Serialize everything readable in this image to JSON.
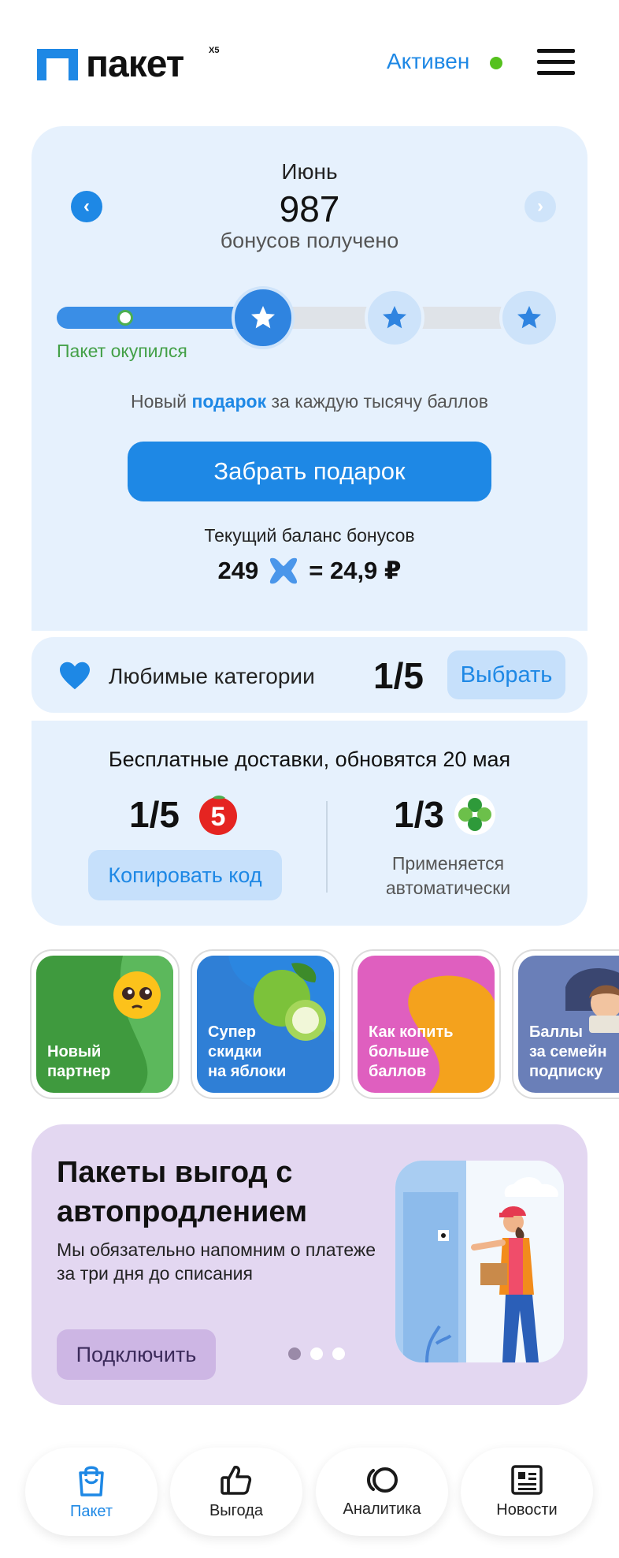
{
  "header": {
    "logo_text": "пакет",
    "logo_badge": "X5",
    "status": "Активен",
    "status_color": "#55c11d"
  },
  "bonus": {
    "month": "Июнь",
    "amount": "987",
    "caption": "бонусов получено",
    "progress_fraction": 0.987,
    "paid_label": "Пакет окупился",
    "gift_prefix": "Новый ",
    "gift_link": "подарок",
    "gift_suffix": " за каждую тысячу баллов",
    "gift_button": "Забрать подарок",
    "balance_title": "Текущий баланс бонусов",
    "balance_points": "249",
    "balance_rub": "= 24,9 ₽"
  },
  "favorites": {
    "label": "Любимые категории",
    "count": "1/5",
    "button": "Выбрать"
  },
  "delivery": {
    "title": "Бесплатные доставки, обновятся 20 мая",
    "store1_count": "1/5",
    "store1_logo": "5",
    "store2_count": "1/3",
    "copy_button": "Копировать код",
    "auto_text": "Применяется автоматически"
  },
  "stories": [
    {
      "line1": "Новый",
      "line2": "партнер",
      "line3": ""
    },
    {
      "line1": "Супер",
      "line2": "скидки",
      "line3": "на яблоки"
    },
    {
      "line1": "Как копить",
      "line2": "больше",
      "line3": "баллов"
    },
    {
      "line1": "Баллы",
      "line2": "за семейн",
      "line3": "подписку"
    }
  ],
  "promo": {
    "title": "Пакеты выгод с автопродлением",
    "subtitle": "Мы обязательно напомним о платеже за три дня до списания",
    "button": "Подключить"
  },
  "nav": [
    {
      "label": "Пакет",
      "icon": "bag-icon",
      "active": true
    },
    {
      "label": "Выгода",
      "icon": "thumbs-up-icon",
      "active": false
    },
    {
      "label": "Аналитика",
      "icon": "analytics-icon",
      "active": false
    },
    {
      "label": "Новости",
      "icon": "newspaper-icon",
      "active": false
    }
  ],
  "colors": {
    "accent": "#1e88e5",
    "card_bg": "#e6f1fd",
    "promo_bg": "#e3d7f1"
  }
}
